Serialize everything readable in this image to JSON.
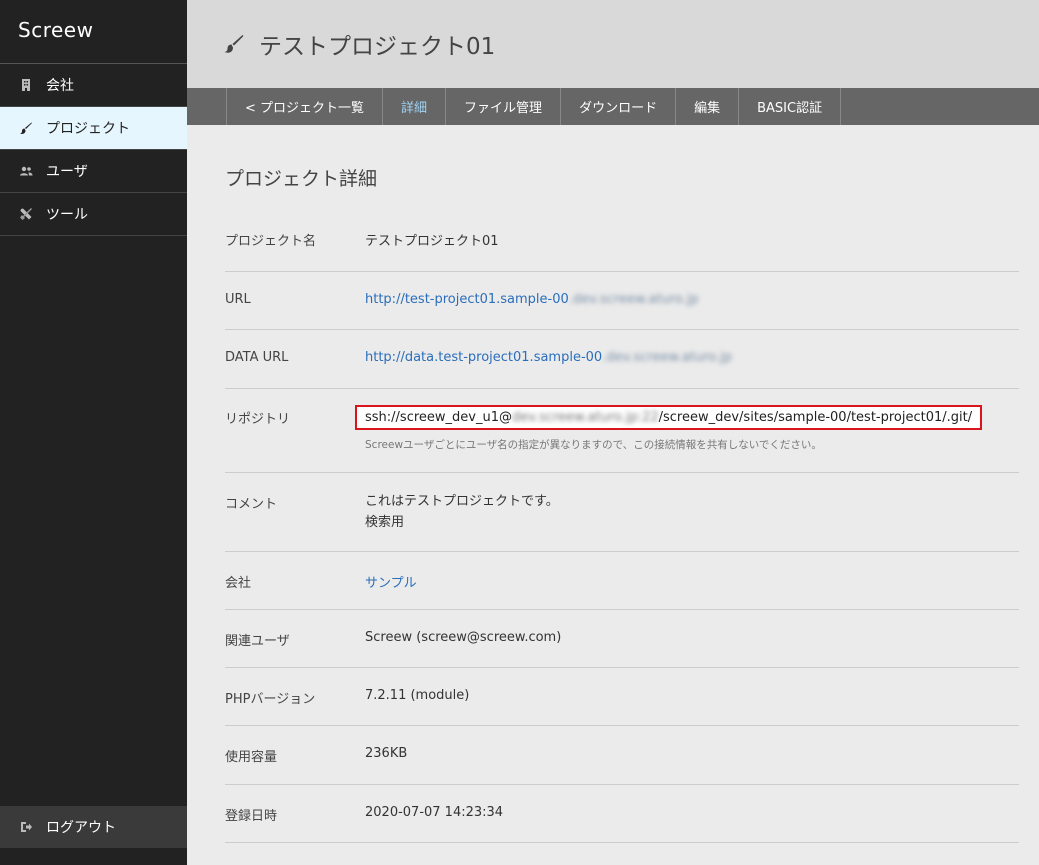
{
  "sidebar": {
    "brand": "Screew",
    "items": [
      {
        "label": "会社",
        "icon": "building-icon"
      },
      {
        "label": "プロジェクト",
        "icon": "brush-icon"
      },
      {
        "label": "ユーザ",
        "icon": "users-icon"
      },
      {
        "label": "ツール",
        "icon": "tools-icon"
      }
    ],
    "logout": {
      "label": "ログアウト",
      "icon": "logout-icon"
    }
  },
  "header": {
    "title": "テストプロジェクト01",
    "icon": "brush-icon"
  },
  "tabs": [
    "< プロジェクト一覧",
    "詳細",
    "ファイル管理",
    "ダウンロード",
    "編集",
    "BASIC認証"
  ],
  "active_tab": "詳細",
  "detail": {
    "title": "プロジェクト詳細",
    "rows": {
      "name": {
        "label": "プロジェクト名",
        "value": "テストプロジェクト01"
      },
      "url": {
        "label": "URL",
        "value": "http://test-project01.sample-00",
        "blurred": ".dev.screew.aturo.jp"
      },
      "data_url": {
        "label": "DATA URL",
        "value": "http://data.test-project01.sample-00",
        "blurred": ".dev.screew.aturo.jp"
      },
      "repo": {
        "label": "リポジトリ",
        "prefix": "ssh://screew_dev_u1@",
        "blurred": "dev.screew.aturo.jp:22",
        "suffix": "/screew_dev/sites/sample-00/test-project01/.git/",
        "note": "Screewユーザごとにユーザ名の指定が異なりますので、この接続情報を共有しないでください。",
        "highlight_color": "#d9141c"
      },
      "comment": {
        "label": "コメント",
        "line1": "これはテストプロジェクトです。",
        "line2": "検索用"
      },
      "company": {
        "label": "会社",
        "value": "サンプル"
      },
      "user": {
        "label": "関連ユーザ",
        "value": "Screew (screew@screew.com)"
      },
      "php": {
        "label": "PHPバージョン",
        "value": "7.2.11 (module)"
      },
      "usage": {
        "label": "使用容量",
        "value": "236KB"
      },
      "created": {
        "label": "登録日時",
        "value": "2020-07-07 14:23:34"
      }
    }
  },
  "colors": {
    "sidebar_bg": "#222222",
    "active_item_bg": "#e6f6fe",
    "tab_bg": "#666666",
    "link": "#2a6ebb",
    "active_tab": "#9fd3f5"
  }
}
